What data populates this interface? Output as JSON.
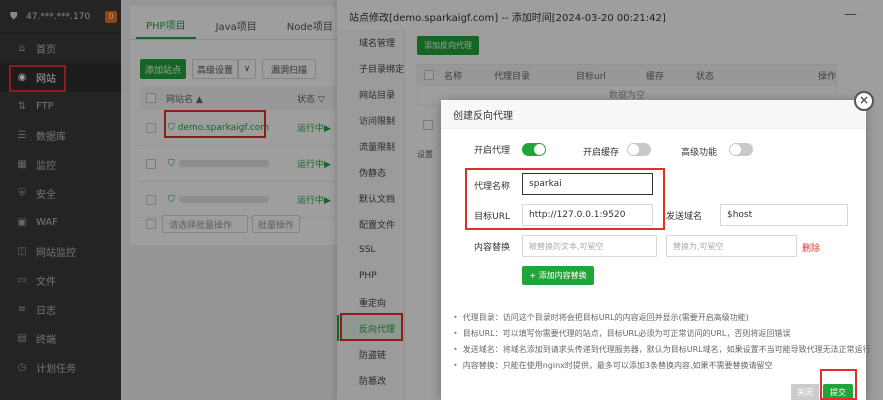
{
  "sidebar": {
    "server_ip": "47.***.***.170",
    "badge": "0",
    "items": [
      {
        "label": "首页",
        "icon": "home-icon",
        "glyph": "⌂"
      },
      {
        "label": "网站",
        "icon": "globe-icon",
        "glyph": "◉"
      },
      {
        "label": "FTP",
        "icon": "ftp-icon",
        "glyph": "⇅"
      },
      {
        "label": "数据库",
        "icon": "database-icon",
        "glyph": "☰"
      },
      {
        "label": "监控",
        "icon": "monitor-icon",
        "glyph": "▦"
      },
      {
        "label": "安全",
        "icon": "shield-icon",
        "glyph": "⛨"
      },
      {
        "label": "WAF",
        "icon": "waf-icon",
        "glyph": "▣"
      },
      {
        "label": "网站监控",
        "icon": "chart-icon",
        "glyph": "◫"
      },
      {
        "label": "文件",
        "icon": "folder-icon",
        "glyph": "▭"
      },
      {
        "label": "日志",
        "icon": "log-icon",
        "glyph": "≡"
      },
      {
        "label": "终端",
        "icon": "terminal-icon",
        "glyph": "▤"
      },
      {
        "label": "计划任务",
        "icon": "clock-icon",
        "glyph": "◷"
      }
    ]
  },
  "main": {
    "tabs": [
      "PHP项目",
      "Java项目",
      "Node项目"
    ],
    "toolbar": {
      "add_site": "添加站点",
      "advanced": "高级设置",
      "dropdown": "∨",
      "expire": "漏洞扫描"
    },
    "table": {
      "col_name": "网站名 ▲",
      "col_status": "状态 ▽"
    },
    "rows": [
      {
        "name": "demo.sparkaigf.com",
        "status": "运行中▶"
      },
      {
        "name": "",
        "status": "运行中▶"
      },
      {
        "name": "",
        "status": "运行中▶"
      }
    ],
    "batch": {
      "select": "请选择批量操作",
      "button": "批量操作"
    }
  },
  "drawer": {
    "title": "站点修改[demo.sparkaigf.com] -- 添加时间[2024-03-20 00:21:42]",
    "close": "—",
    "menu": [
      "域名管理",
      "子目录绑定",
      "网站目录",
      "访问限制",
      "流量限制",
      "伪静态",
      "默认文档",
      "配置文件",
      "SSL",
      "PHP",
      "重定向",
      "反向代理",
      "防盗链",
      "防篡改"
    ],
    "add_proxy": "添加反向代理",
    "table_headers": [
      "名称",
      "代理目录",
      "目标url",
      "缓存",
      "状态",
      "操作"
    ],
    "no_data": "数据为空",
    "note_peek": "设置"
  },
  "modal": {
    "title": "创建反向代理",
    "close": "×",
    "toggles": {
      "enable_proxy": {
        "label": "开启代理",
        "on": true
      },
      "enable_cache": {
        "label": "开启缓存",
        "on": false
      },
      "advanced": {
        "label": "高级功能",
        "on": false
      }
    },
    "proxy_name": {
      "label": "代理名称",
      "value": "sparkai"
    },
    "target_url": {
      "label": "目标URL",
      "value": "http://127.0.0.1:9520"
    },
    "send_domain": {
      "label": "发送域名",
      "value": "$host"
    },
    "content_replace": {
      "label": "内容替换",
      "placeholder1": "被替换的文本,可留空",
      "placeholder2": "替换为,可留空",
      "delete": "删除"
    },
    "add_replace": "+ 添加内容替换",
    "notes": [
      "代理目录：访问这个目录时将会把目标URL的内容返回并显示(需要开启高级功能)",
      "目标URL：可以填写你需要代理的站点，目标URL必须为可正常访问的URL，否则将返回错误",
      "发送域名：将域名添加到请求头传递到代理服务器，默认为目标URL域名，如果设置不当可能导致代理无法正常运行",
      "内容替换：只能在使用nginx时提供，最多可以添加3条替换内容,如果不需要替换请留空"
    ],
    "close_button": "关闭",
    "submit_button": "提交"
  },
  "colors": {
    "accent": "#20a53a",
    "highlight": "#e0302a",
    "sidebar": "#3a3a3a"
  }
}
